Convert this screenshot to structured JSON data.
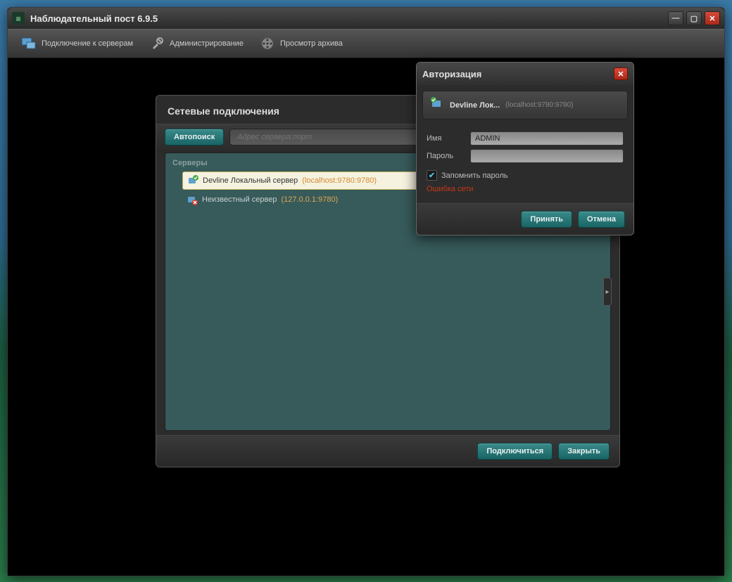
{
  "window": {
    "title": "Наблюдательный пост 6.9.5"
  },
  "toolbar": {
    "connect": "Подключение к серверам",
    "admin": "Администрирование",
    "archive": "Просмотр архива"
  },
  "network_dialog": {
    "title": "Сетевые подключения",
    "autosearch": "Автопоиск",
    "address_placeholder": "Адрес сервера:порт",
    "servers_label": "Серверы",
    "servers": [
      {
        "name": "Devline Локальный сервер",
        "addr": "(localhost:9780:9780)",
        "selected": true,
        "status": "ok"
      },
      {
        "name": "Неизвестный сервер",
        "addr": "(127.0.0.1:9780)",
        "selected": false,
        "status": "error"
      }
    ],
    "connect_btn": "Подключиться",
    "close_btn": "Закрыть"
  },
  "auth_dialog": {
    "title": "Авторизация",
    "server_name": "Devline Лок...",
    "server_addr": "(localhost:9780:9780)",
    "username_label": "Имя",
    "username_value": "ADMIN",
    "password_label": "Пароль",
    "password_value": "",
    "remember_label": "Запомнить пароль",
    "remember_checked": true,
    "error": "Ошибка сети",
    "accept_btn": "Принять",
    "cancel_btn": "Отмена"
  }
}
